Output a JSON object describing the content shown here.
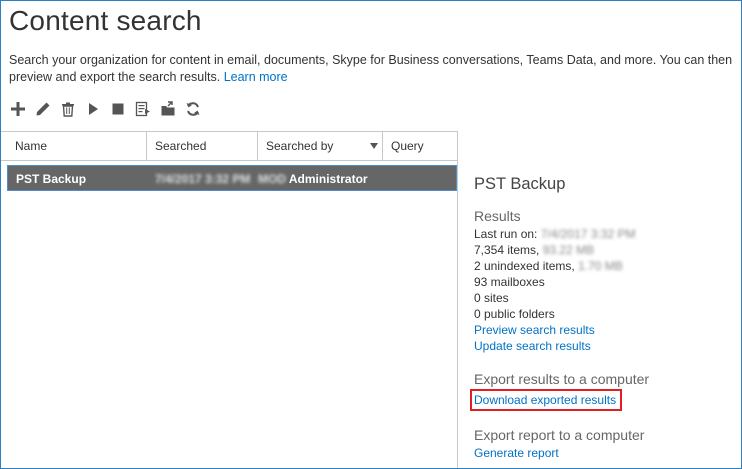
{
  "page": {
    "title": "Content search",
    "description": "Search your organization for content in email, documents, Skype for Business conversations, Teams Data, and more. You can then preview and export the search results. ",
    "learn_more": "Learn more"
  },
  "toolbar": {
    "icons": [
      "add-icon",
      "edit-icon",
      "delete-icon",
      "start-icon",
      "stop-icon",
      "export-report-icon",
      "export-results-icon",
      "refresh-icon"
    ]
  },
  "table": {
    "columns": [
      "Name",
      "Searched",
      "Searched by",
      "Query"
    ],
    "rows": [
      {
        "name": "PST Backup",
        "searched": "7/4/2017 3:32 PM",
        "searched_by_prefix": "MOD",
        "searched_by": " Administrator"
      }
    ]
  },
  "details": {
    "name": "PST Backup",
    "results_heading": "Results",
    "last_run_label": "Last run on: ",
    "last_run_value": "7/4/2017 3:32 PM",
    "items_label": "7,354 items, ",
    "items_size": "93.22 MB",
    "unindexed_label": "2 unindexed items, ",
    "unindexed_size": "1.70 MB",
    "mailboxes": "93 mailboxes",
    "sites": "0 sites",
    "public_folders": "0 public folders",
    "preview_link": "Preview search results",
    "update_link": "Update search results",
    "export_results_heading": "Export results to a computer",
    "download_link": "Download exported results",
    "export_report_heading": "Export report to a computer",
    "generate_report_link": "Generate report"
  },
  "colors": {
    "accent_link": "#0072c6",
    "selected_row": "#666666",
    "highlight_box": "#e01e24",
    "frame_border": "#2d7fc1"
  }
}
